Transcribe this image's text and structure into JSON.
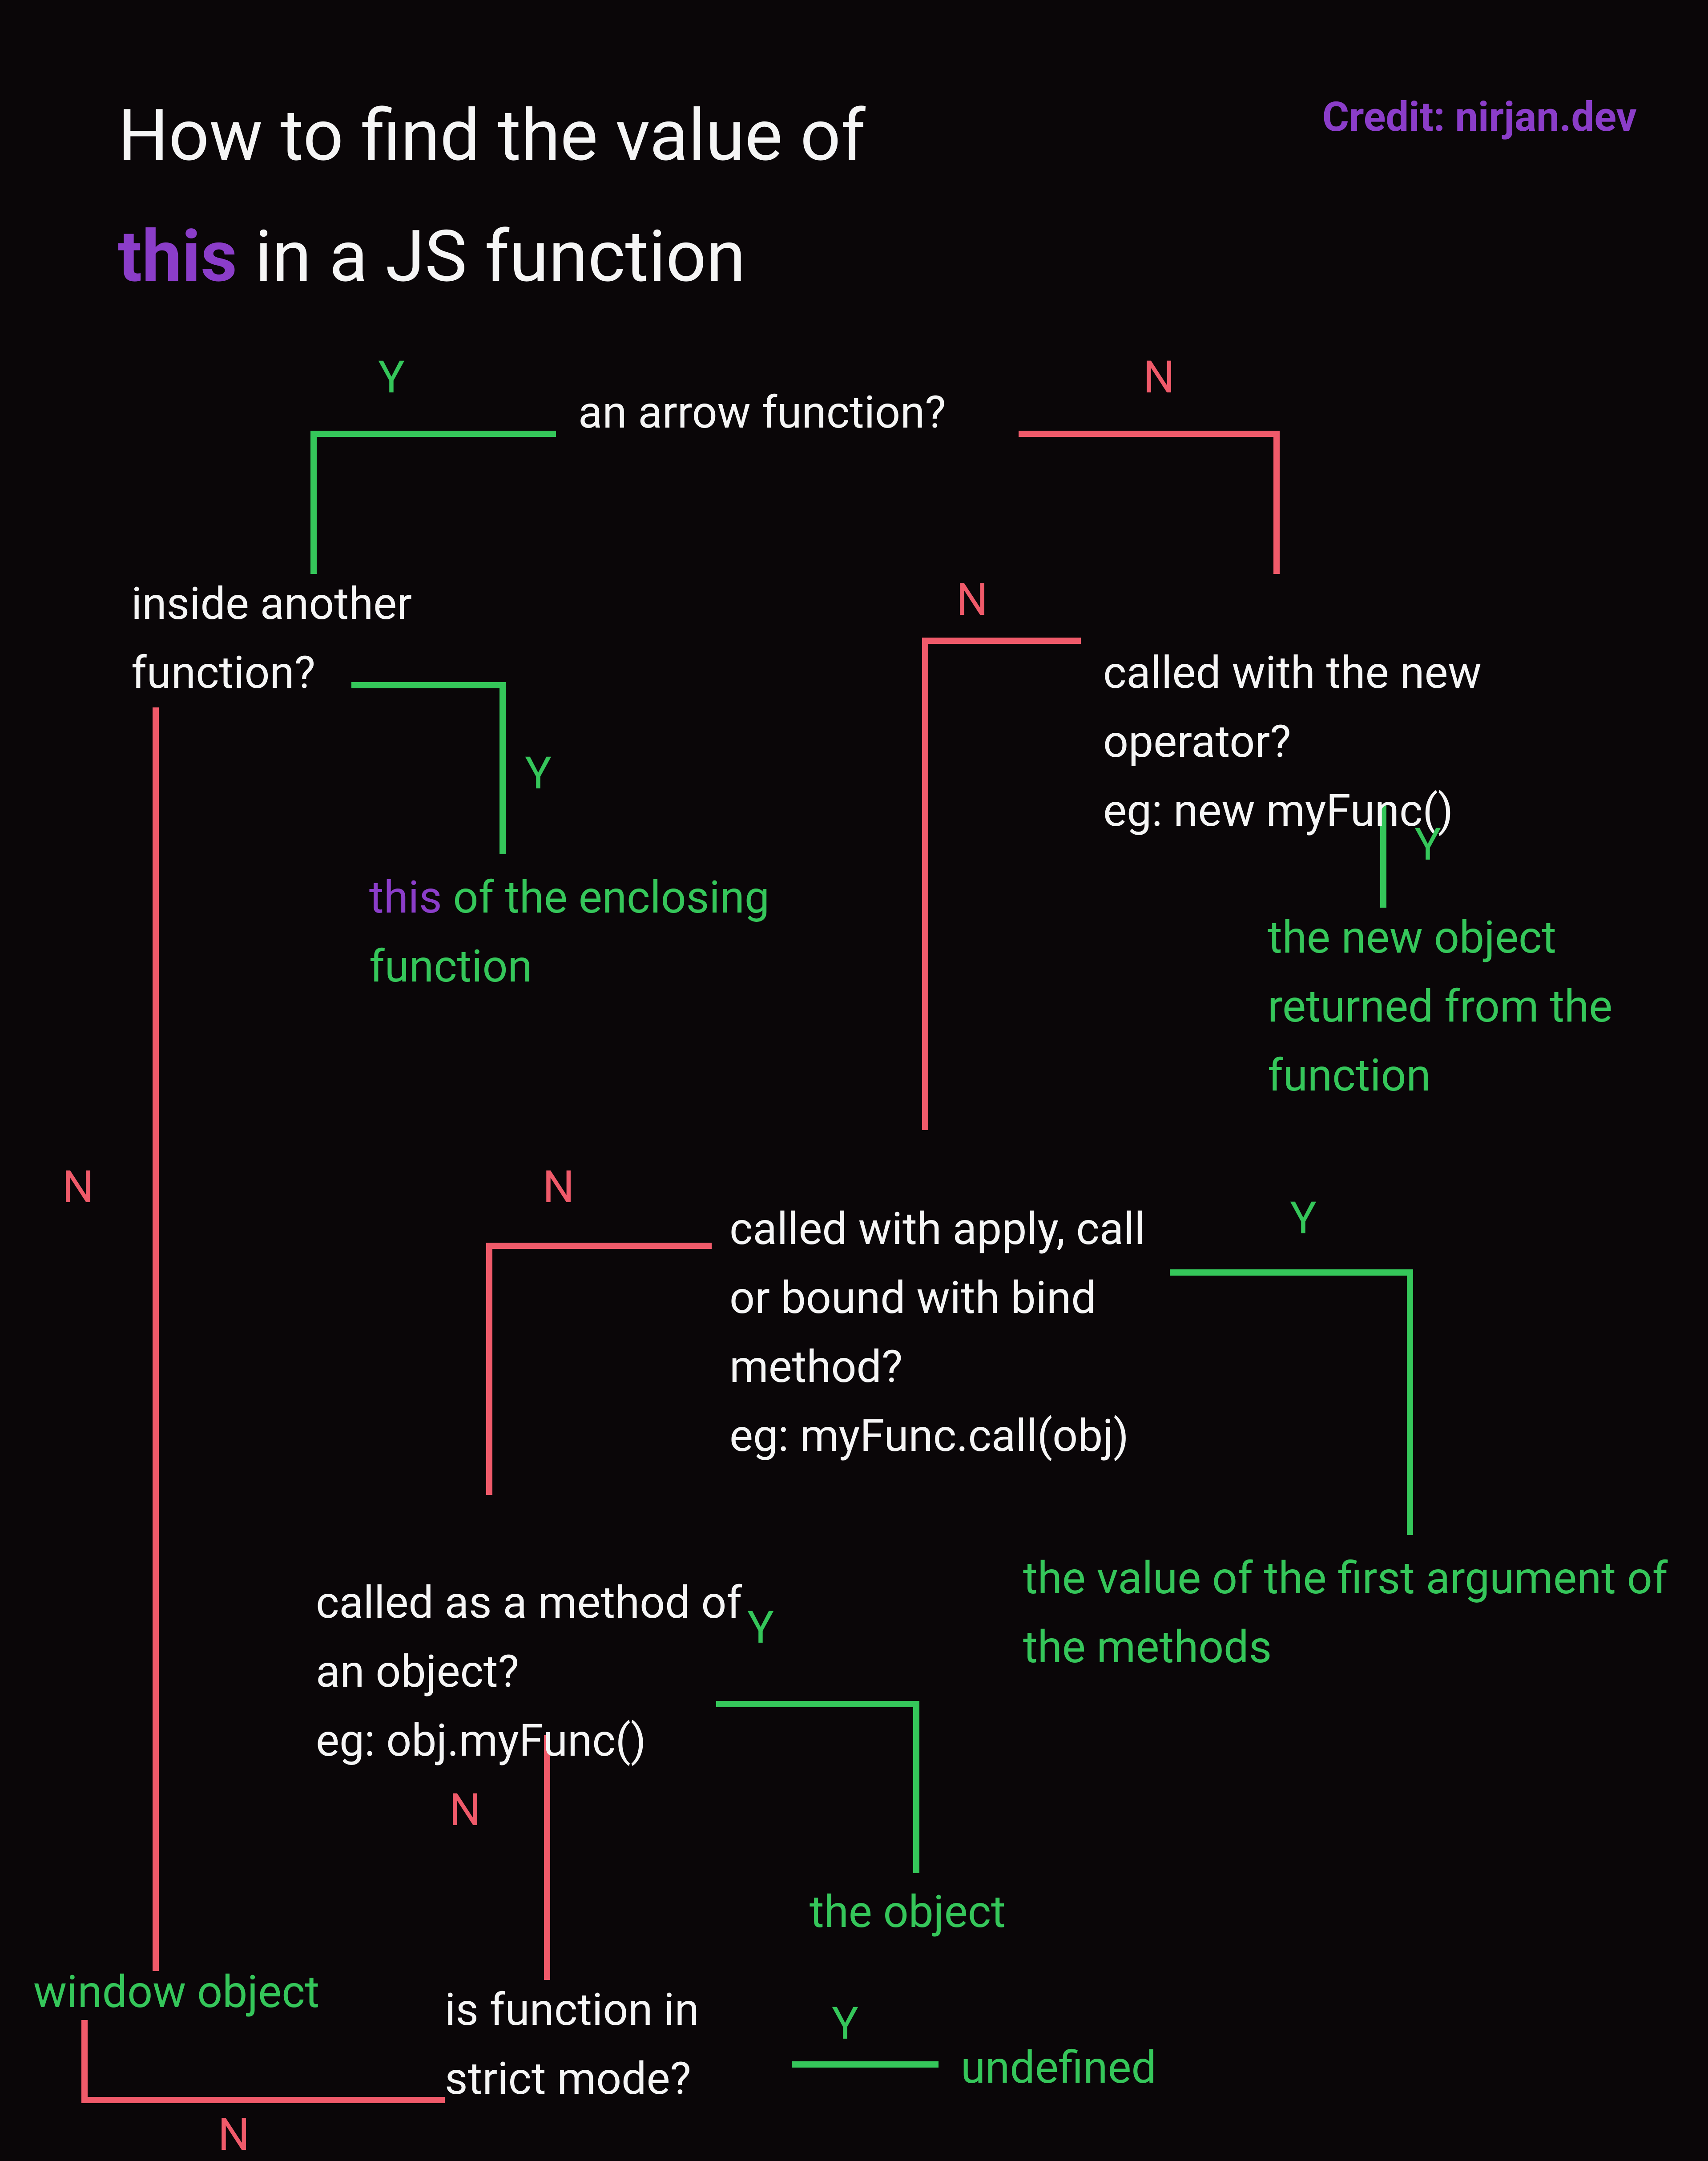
{
  "title": {
    "line1": "How to find the value of ",
    "keyword": "this",
    "line2_rest": " in a JS function"
  },
  "credit": "Credit: nirjan.dev",
  "labels": {
    "yes": "Y",
    "no": "N"
  },
  "questions": {
    "arrow": "an arrow function?",
    "inside": "inside another function?",
    "new_op": "called with the new operator?\neg: new myFunc()",
    "apply": "called with apply, call or bound with bind method?\neg: myFunc.call(obj)",
    "method": "called as a method of an object?\neg: obj.myFunc()",
    "strict": "is function in strict mode?"
  },
  "answers": {
    "enclosing_kw": "this",
    "enclosing_rest": " of the enclosing function",
    "new_obj": "the new object returned from the function",
    "first_arg": "the value of the first argument of the methods",
    "the_object": "the object",
    "undef": "undefined",
    "window": "window object"
  },
  "chart_data": {
    "type": "flowchart",
    "title": "How to find the value of this in a JS function",
    "nodes": [
      {
        "id": "q_arrow",
        "kind": "decision",
        "text": "an arrow function?"
      },
      {
        "id": "q_inside",
        "kind": "decision",
        "text": "inside another function?"
      },
      {
        "id": "q_new",
        "kind": "decision",
        "text": "called with the new operator? eg: new myFunc()"
      },
      {
        "id": "q_apply",
        "kind": "decision",
        "text": "called with apply, call or bound with bind method? eg: myFunc.call(obj)"
      },
      {
        "id": "q_method",
        "kind": "decision",
        "text": "called as a method of an object? eg: obj.myFunc()"
      },
      {
        "id": "q_strict",
        "kind": "decision",
        "text": "is function in strict mode?"
      },
      {
        "id": "a_enclosing",
        "kind": "result",
        "text": "this of the enclosing function"
      },
      {
        "id": "a_new",
        "kind": "result",
        "text": "the new object returned from the function"
      },
      {
        "id": "a_firstarg",
        "kind": "result",
        "text": "the value of the first argument of the methods"
      },
      {
        "id": "a_object",
        "kind": "result",
        "text": "the object"
      },
      {
        "id": "a_undef",
        "kind": "result",
        "text": "undefined"
      },
      {
        "id": "a_window",
        "kind": "result",
        "text": "window object"
      }
    ],
    "edges": [
      {
        "from": "q_arrow",
        "to": "q_inside",
        "label": "Y"
      },
      {
        "from": "q_arrow",
        "to": "q_new",
        "label": "N"
      },
      {
        "from": "q_inside",
        "to": "a_enclosing",
        "label": "Y"
      },
      {
        "from": "q_inside",
        "to": "a_window",
        "label": "N"
      },
      {
        "from": "q_new",
        "to": "a_new",
        "label": "Y"
      },
      {
        "from": "q_new",
        "to": "q_apply",
        "label": "N"
      },
      {
        "from": "q_apply",
        "to": "a_firstarg",
        "label": "Y"
      },
      {
        "from": "q_apply",
        "to": "q_method",
        "label": "N"
      },
      {
        "from": "q_method",
        "to": "a_object",
        "label": "Y"
      },
      {
        "from": "q_method",
        "to": "q_strict",
        "label": "N"
      },
      {
        "from": "q_strict",
        "to": "a_undef",
        "label": "Y"
      },
      {
        "from": "q_strict",
        "to": "a_window",
        "label": "N"
      }
    ]
  }
}
